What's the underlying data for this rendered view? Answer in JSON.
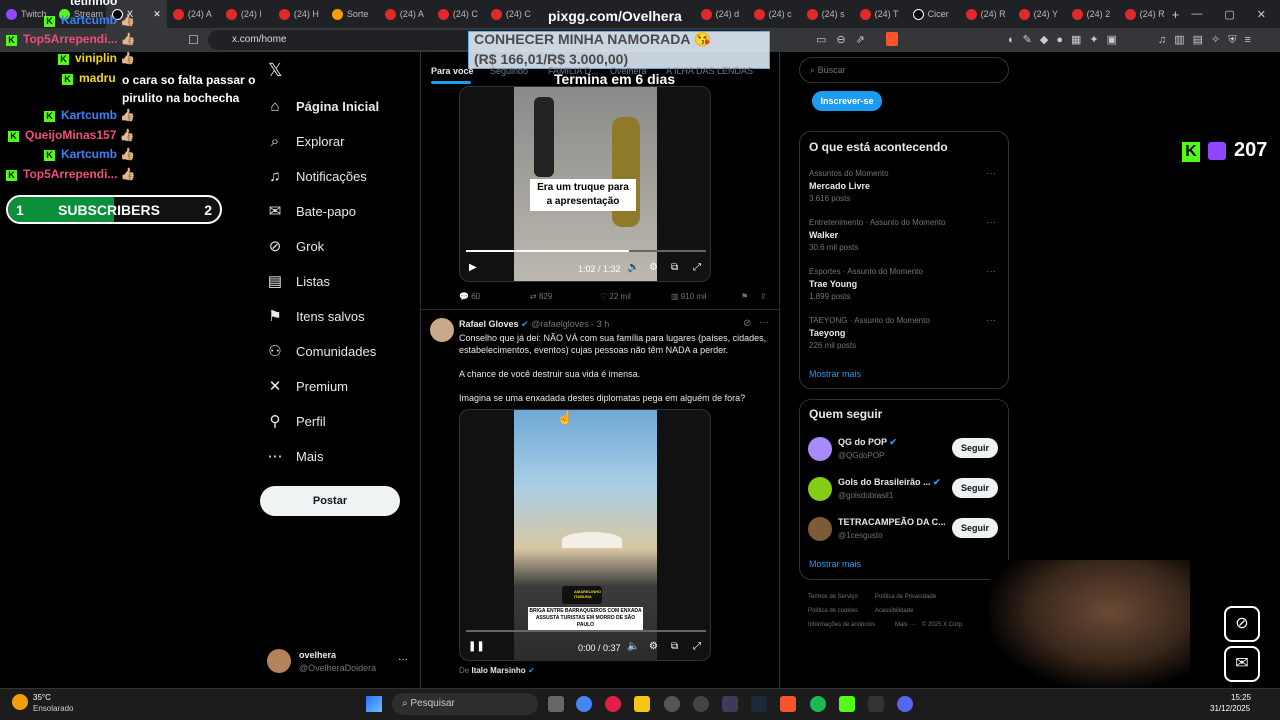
{
  "browser": {
    "tabs": [
      "Twitch",
      "Stream",
      "X",
      "(24) A",
      "(24) l",
      "(24) H",
      "Sorte",
      "(24) A",
      "(24) C",
      "(24) C",
      "(24) d",
      "(24) c",
      "(24) s",
      "(24) T",
      "Cicer",
      "(24) R",
      "(24) Y",
      "(24) 2",
      "(24) R"
    ],
    "url": "x.com/home"
  },
  "overlay": {
    "site": "pixgg.com/Ovelhera",
    "promo_title": "CONHECER MINHA NAMORADA",
    "promo_price": "(R$ 166,01/R$ 3.000,00)",
    "promo_ends": "Termina em 6 dias",
    "kick_viewers": "207",
    "subs_left": "1",
    "subs_label": "SUBSCRIBERS",
    "subs_right": "2"
  },
  "chat": [
    {
      "user": "Kartcumb",
      "color": "#3b82f6",
      "msg": ""
    },
    {
      "user": "Top5Arrependi...",
      "color": "#ef4f7a",
      "msg": ""
    },
    {
      "user": "viniplin",
      "color": "#f5d90a",
      "msg": ""
    },
    {
      "user": "madru",
      "color": "#f5d90a",
      "msg": "o cara so falta passar o pirulito na bochecha"
    },
    {
      "user": "Kartcumb",
      "color": "#3b82f6",
      "msg": ""
    },
    {
      "user": "QueijoMinas157",
      "color": "#ef4f7a",
      "msg": ""
    },
    {
      "user": "Kartcumb",
      "color": "#3b82f6",
      "msg": ""
    },
    {
      "user": "Top5Arrependi...",
      "color": "#ef4f7a",
      "msg": ""
    }
  ],
  "chat_top_user": "tetinhoo",
  "nav": {
    "items": [
      "Página Inicial",
      "Explorar",
      "Notificações",
      "Bate-papo",
      "Grok",
      "Listas",
      "Itens salvos",
      "Comunidades",
      "Premium",
      "Perfil",
      "Mais"
    ],
    "post_label": "Postar",
    "account_name": "ovelhera",
    "account_handle": "@OvelheraDoidera"
  },
  "feed": {
    "tabs": [
      "Para você",
      "Seguindo",
      "FAMILIA D...",
      "Ovelhera",
      "A ILHA DAS LENDAS"
    ],
    "video1": {
      "caption": "Era um truque para a apresentação",
      "time": "1:02 / 1:32"
    },
    "stats1": {
      "replies": "60",
      "reposts": "829",
      "likes": "22 mil",
      "views": "910 mil"
    },
    "tweet2": {
      "name": "Rafael Gloves",
      "handle": "@rafaelgloves",
      "age": "· 3 h",
      "p1": "Conselho que já dei: NÃO VÁ com sua família para lugares (países, cidades, estabelecimentos, eventos) cujas pessoas não têm NADA a perder.",
      "p2": "A chance de você destruir sua vida é imensa.",
      "p3": "Imagina se uma enxadada destes diplomatas pega em alguém de fora?",
      "video_time": "0:00 / 0:37",
      "video_caption": "BRIGA ENTRE BARRAQUEIROS COM ENXADA ASSUSTA TURISTAS EM MORRO DE SÃO PAULO",
      "video_brand": "AMARELINHO ITABUNA",
      "from_label": "De",
      "from_user": "Italo Marsinho"
    }
  },
  "right": {
    "search_placeholder": "Buscar",
    "subscribe_label": "Inscrever-se",
    "trends_title": "O que está acontecendo",
    "trends": [
      {
        "meta": "Assuntos do Momento",
        "name": "Mercado Livre",
        "count": "3.616 posts"
      },
      {
        "meta": "Entretenimento · Assunto do Momento",
        "name": "Walker",
        "count": "30,6 mil posts"
      },
      {
        "meta": "Esportes · Assunto do Momento",
        "name": "Trae Young",
        "count": "1.899 posts"
      },
      {
        "meta": "TAEYONG · Assunto do Momento",
        "name": "Taeyong",
        "count": "226 mil posts"
      }
    ],
    "show_more": "Mostrar mais",
    "follow_title": "Quem seguir",
    "follows": [
      {
        "name": "QG do POP",
        "handle": "@QGdoPOP",
        "avatar_color": "#a78bfa"
      },
      {
        "name": "Gols do Brasileirão ...",
        "handle": "@golsdobrasil1",
        "avatar_color": "#84cc16"
      },
      {
        "name": "TETRACAMPEÃO DA C...",
        "handle": "@1cesgusto",
        "avatar_color": "#7c5a3a"
      }
    ],
    "follow_label": "Seguir",
    "show_more2": "Mostrar mais",
    "footer": [
      "Termos de Serviço",
      "Política de Privacidade",
      "Política de cookies",
      "Acessibilidade",
      "Informações de anúncios",
      "Mais ···",
      "© 2025 X Corp."
    ]
  },
  "taskbar": {
    "weather_temp": "35°C",
    "weather_desc": "Ensolarado",
    "search_placeholder": "Pesquisar",
    "time": "15:25",
    "date": "31/12/2025"
  }
}
